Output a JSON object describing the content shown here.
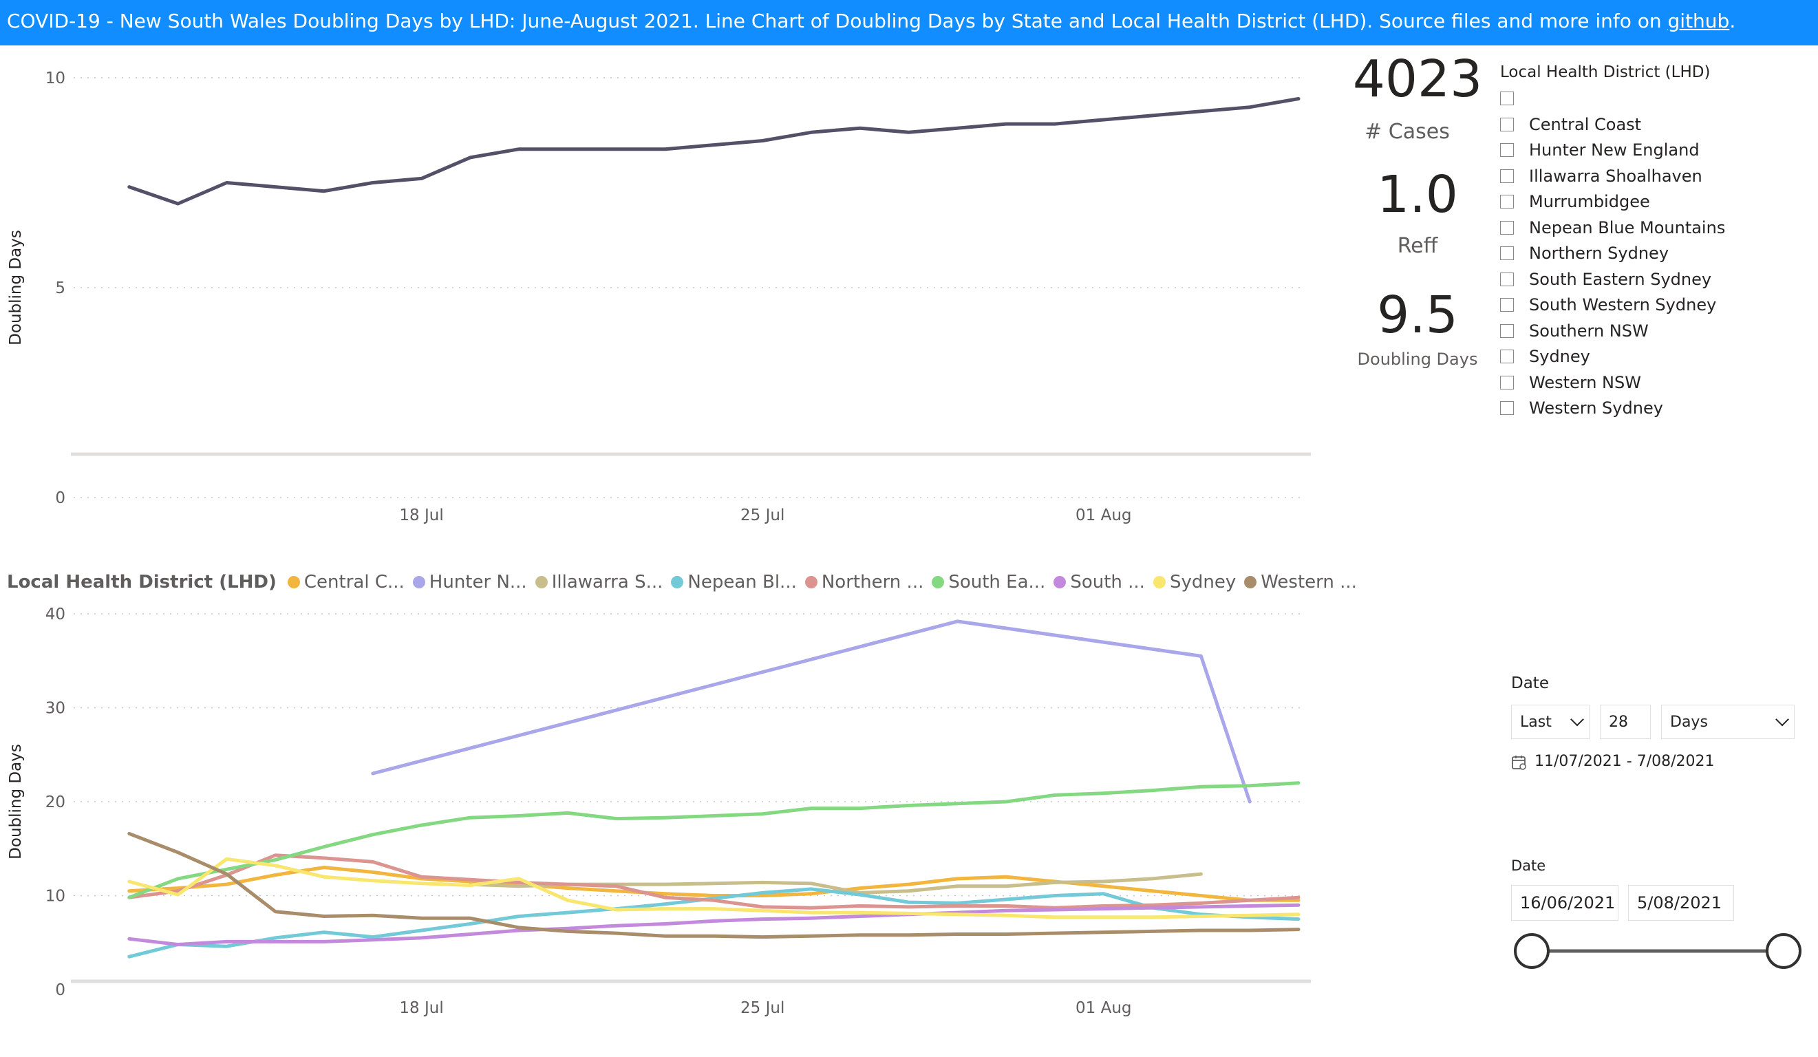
{
  "banner": {
    "text": "COVID-19  - New South Wales Doubling Days by LHD: June-August  2021.  Line Chart of Doubling Days  by State and Local Health District (LHD). Source files and more info on ",
    "link": "github",
    "suffix": "."
  },
  "kpis": {
    "cases_value": "4023",
    "cases_label": "# Cases",
    "reff_value": "1.0",
    "reff_label": "Reff",
    "doubling_value": "9.5",
    "doubling_label": "Doubling Days"
  },
  "lhd_slicer": {
    "title": "Local Health District (LHD)",
    "items": [
      "",
      "Central Coast",
      "Hunter New England",
      "Illawarra Shoalhaven",
      "Murrumbidgee",
      "Nepean Blue Mountains",
      "Northern Sydney",
      "South Eastern Sydney",
      "South Western Sydney",
      "Southern NSW",
      "Sydney",
      "Western NSW",
      "Western Sydney"
    ]
  },
  "date_filter": {
    "title": "Date",
    "mode": "Last",
    "count": "28",
    "unit": "Days",
    "range_text": "11/07/2021 - 7/08/2021"
  },
  "date_range": {
    "title": "Date",
    "start": "16/06/2021",
    "end": "5/08/2021",
    "start_fraction": 0,
    "end_fraction": 1
  },
  "legend": {
    "title": "Local Health District (LHD)",
    "items": [
      {
        "label": "Central C...",
        "color": "#F2B53D"
      },
      {
        "label": "Hunter N...",
        "color": "#A9A6EA"
      },
      {
        "label": "Illawarra S...",
        "color": "#C8BE8C"
      },
      {
        "label": "Nepean Bl...",
        "color": "#72CAD8"
      },
      {
        "label": "Northern ...",
        "color": "#DB9490"
      },
      {
        "label": "South Ea...",
        "color": "#84D882"
      },
      {
        "label": "South ...",
        "color": "#C389DC"
      },
      {
        "label": "Sydney",
        "color": "#F8E66F"
      },
      {
        "label": "Western ...",
        "color": "#A98D6A"
      }
    ]
  },
  "icons": {
    "calendar": "calendar-icon",
    "chevron": "chevron-down-icon"
  },
  "chart_data": [
    {
      "type": "line",
      "ylabel": "Doubling Days",
      "ylim": [
        0,
        10
      ],
      "yticks": [
        "0",
        "5",
        "10"
      ],
      "xticks": [
        {
          "day": 18,
          "label": "18 Jul"
        },
        {
          "day": 25,
          "label": "25 Jul"
        },
        {
          "day": 32,
          "label": "01 Aug"
        }
      ],
      "xlim": [
        "2021-07-11",
        "2021-08-05"
      ],
      "grid": true,
      "series": [
        {
          "color": "#535067",
          "x": [
            "2021-07-12",
            "2021-07-13",
            "2021-07-14",
            "2021-07-15",
            "2021-07-16",
            "2021-07-17",
            "2021-07-18",
            "2021-07-19",
            "2021-07-20",
            "2021-07-21",
            "2021-07-22",
            "2021-07-23",
            "2021-07-24",
            "2021-07-25",
            "2021-07-26",
            "2021-07-27",
            "2021-07-28",
            "2021-07-29",
            "2021-07-30",
            "2021-07-31",
            "2021-08-01",
            "2021-08-02",
            "2021-08-03",
            "2021-08-04",
            "2021-08-05"
          ],
          "y": [
            7.4,
            7.0,
            7.5,
            7.4,
            7.3,
            7.5,
            7.6,
            8.1,
            8.3,
            8.3,
            8.3,
            8.3,
            8.4,
            8.5,
            8.7,
            8.8,
            8.7,
            8.8,
            8.9,
            8.9,
            9.0,
            9.1,
            9.2,
            9.3,
            9.5
          ]
        }
      ]
    },
    {
      "type": "line",
      "ylabel": "Doubling Days",
      "ylim": [
        0,
        40
      ],
      "yticks": [
        "0",
        "10",
        "20",
        "30",
        "40"
      ],
      "xticks": [
        {
          "day": 18,
          "label": "18 Jul"
        },
        {
          "day": 25,
          "label": "25 Jul"
        },
        {
          "day": 32,
          "label": "01 Aug"
        }
      ],
      "xlim": [
        "2021-07-11",
        "2021-08-05"
      ],
      "grid": true,
      "x": [
        "2021-07-12",
        "2021-07-13",
        "2021-07-14",
        "2021-07-15",
        "2021-07-16",
        "2021-07-17",
        "2021-07-18",
        "2021-07-19",
        "2021-07-20",
        "2021-07-21",
        "2021-07-22",
        "2021-07-23",
        "2021-07-24",
        "2021-07-25",
        "2021-07-26",
        "2021-07-27",
        "2021-07-28",
        "2021-07-29",
        "2021-07-30",
        "2021-07-31",
        "2021-08-01",
        "2021-08-02",
        "2021-08-03",
        "2021-08-04",
        "2021-08-05"
      ],
      "series": [
        {
          "name": "Central C...",
          "color": "#F2B53D",
          "y": [
            10.5,
            10.8,
            11.2,
            12.2,
            13.0,
            12.5,
            11.8,
            11.5,
            11.2,
            10.8,
            10.5,
            10.2,
            10.0,
            10.0,
            10.2,
            10.8,
            11.2,
            11.8,
            12.0,
            11.5,
            11.0,
            10.5,
            10.0,
            9.5,
            9.5
          ]
        },
        {
          "name": "Hunter N...",
          "color": "#A9A6EA",
          "y": [
            null,
            null,
            null,
            null,
            null,
            23.0,
            null,
            null,
            null,
            null,
            null,
            null,
            null,
            null,
            null,
            null,
            null,
            39.2,
            null,
            null,
            null,
            null,
            35.5,
            20.0,
            null
          ]
        },
        {
          "name": "Illawarra S...",
          "color": "#C8BE8C",
          "y": [
            null,
            null,
            null,
            null,
            null,
            null,
            null,
            11.2,
            11.0,
            11.2,
            11.2,
            11.2,
            11.3,
            11.4,
            11.3,
            10.3,
            10.5,
            11.0,
            11.0,
            11.4,
            11.5,
            11.8,
            12.3,
            null,
            null
          ]
        },
        {
          "name": "Nepean Bl...",
          "color": "#72CAD8",
          "y": [
            3.5,
            4.8,
            4.6,
            5.5,
            6.1,
            5.6,
            6.3,
            7.0,
            7.8,
            8.2,
            8.6,
            9.1,
            9.7,
            10.3,
            10.7,
            10.1,
            9.3,
            9.2,
            9.6,
            10.0,
            10.2,
            8.7,
            8.0,
            7.7,
            7.5
          ]
        },
        {
          "name": "Northern ...",
          "color": "#DB9490",
          "y": [
            9.8,
            10.5,
            12.2,
            14.3,
            14.0,
            13.6,
            12.0,
            11.7,
            11.4,
            11.2,
            11.0,
            9.8,
            9.5,
            8.8,
            8.7,
            8.9,
            8.8,
            8.9,
            8.9,
            8.7,
            8.9,
            9.0,
            9.2,
            9.5,
            9.8
          ]
        },
        {
          "name": "South Ea...",
          "color": "#84D882",
          "y": [
            9.8,
            11.8,
            12.8,
            13.8,
            15.2,
            16.5,
            17.5,
            18.3,
            18.5,
            18.8,
            18.2,
            18.3,
            18.5,
            18.7,
            19.3,
            19.3,
            19.6,
            19.8,
            20.0,
            20.7,
            20.9,
            21.2,
            21.6,
            21.7,
            22.0
          ]
        },
        {
          "name": "South ...",
          "color": "#C389DC",
          "y": [
            5.4,
            4.8,
            5.1,
            5.1,
            5.1,
            5.3,
            5.5,
            5.9,
            6.3,
            6.5,
            6.8,
            7.0,
            7.3,
            7.5,
            7.6,
            7.8,
            8.0,
            8.2,
            8.4,
            8.5,
            8.6,
            8.7,
            8.8,
            8.9,
            9.0
          ]
        },
        {
          "name": "Sydney",
          "color": "#F8E66F",
          "y": [
            11.5,
            10.1,
            13.9,
            13.2,
            12.0,
            11.6,
            11.3,
            11.1,
            11.8,
            9.5,
            8.5,
            8.6,
            8.6,
            8.4,
            8.2,
            8.2,
            8.1,
            8.0,
            7.9,
            7.7,
            7.7,
            7.7,
            7.8,
            7.9,
            8.0
          ]
        },
        {
          "name": "Western ...",
          "color": "#A98D6A",
          "y": [
            16.6,
            14.6,
            12.3,
            8.3,
            7.8,
            7.9,
            7.6,
            7.6,
            6.6,
            6.2,
            6.0,
            5.7,
            5.7,
            5.6,
            5.7,
            5.8,
            5.8,
            5.9,
            5.9,
            6.0,
            6.1,
            6.2,
            6.3,
            6.3,
            6.4
          ]
        }
      ]
    }
  ]
}
